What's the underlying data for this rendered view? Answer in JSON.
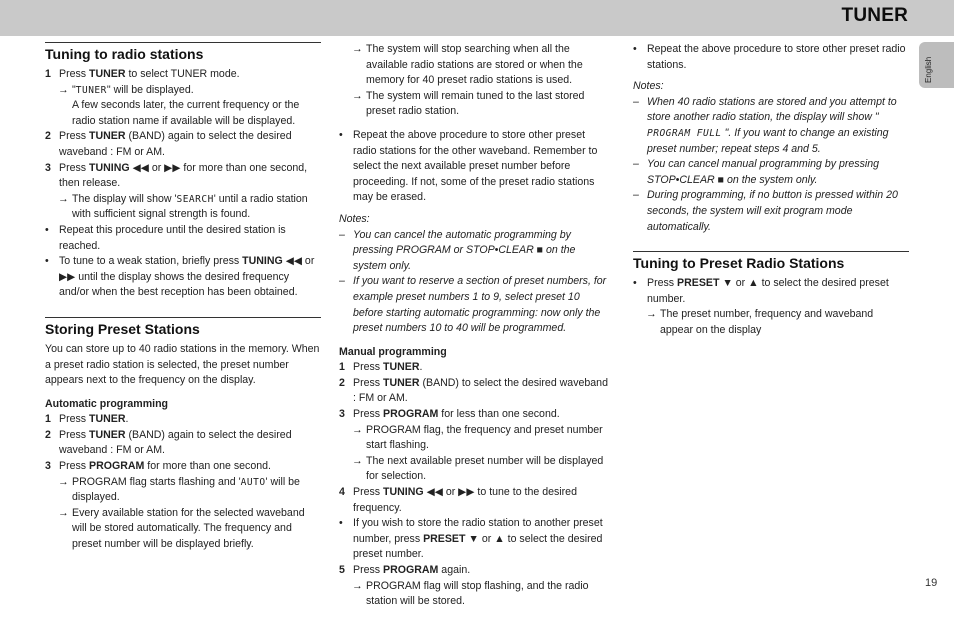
{
  "header": {
    "title": "TUNER",
    "language_tab": "English",
    "page_number": "19"
  },
  "col1": {
    "tuning": {
      "title": "Tuning to radio stations",
      "s1_num": "1",
      "s1_a": "Press ",
      "s1_b": "TUNER",
      "s1_c": " to select TUNER mode.",
      "s1_arrow_a": "\"",
      "s1_arrow_lcd": "TUNER",
      "s1_arrow_c": "\" will be displayed.",
      "s1_cont": "A few seconds later, the current frequency or the radio station name if available will be displayed.",
      "s2_num": "2",
      "s2_a": "Press ",
      "s2_b": "TUNER",
      "s2_c": " (BAND) again to select the desired waveband : FM or AM.",
      "s3_num": "3",
      "s3_a": "Press ",
      "s3_b": "TUNING",
      "s3_c": " ◀◀ or ▶▶ for more than one second, then release.",
      "s3_arrow_a": "The display will show '",
      "s3_arrow_lcd": "SEARCH",
      "s3_arrow_c": "' until a radio station with sufficient signal strength is found.",
      "b1": "Repeat this procedure until the desired station is reached.",
      "b2_a": "To tune to a weak station, briefly press ",
      "b2_b": "TUNING",
      "b2_c": " ◀◀ or ▶▶ until the display shows the desired frequency and/or when the best reception has been obtained."
    },
    "storing": {
      "title": "Storing Preset Stations",
      "intro": "You can store up to 40 radio stations in the memory. When a preset radio station is selected, the preset number appears next to the frequency on the display.",
      "auto_title": "Automatic programming",
      "s1_a": "Press ",
      "s1_b": "TUNER",
      "s1_c": ".",
      "s2_a": "Press ",
      "s2_b": "TUNER",
      "s2_c": " (BAND) again to select the desired waveband : FM or AM.",
      "s3_a": "Press ",
      "s3_b": "PROGRAM",
      "s3_c": " for more than one second.",
      "s3_arrow1_a": "PROGRAM flag starts flashing and '",
      "s3_arrow1_lcd": "AUTO",
      "s3_arrow1_c": "' will be displayed.",
      "s3_arrow2": "Every available station for the selected waveband will be stored automatically. The frequency and preset number will be displayed briefly."
    }
  },
  "col2": {
    "arrow1": "The system  will stop searching when all the available radio stations are stored or when the memory for 40 preset radio stations is used.",
    "arrow2": "The system will remain tuned to the last stored preset radio station.",
    "bullet1": "Repeat the above procedure to store other preset radio stations for the other waveband. Remember to select the next available preset number before proceeding. If not, some of the preset radio stations may be erased.",
    "notes_title": "Notes:",
    "note1": "You can cancel the automatic programming by pressing PROGRAM or STOP•CLEAR  ■  on the system only.",
    "note2": "If you want to reserve a section of  preset numbers, for example preset numbers 1 to 9, select preset 10 before starting automatic programming: now only the preset numbers 10 to 40 will be programmed.",
    "manual_title": "Manual programming",
    "m1_a": "Press ",
    "m1_b": "TUNER",
    "m1_c": ".",
    "m2_a": "Press ",
    "m2_b": "TUNER",
    "m2_c": " (BAND) to select the desired waveband : FM or AM.",
    "m3_a": "Press ",
    "m3_b": "PROGRAM",
    "m3_c": " for less than one second.",
    "m3_arrow1": "PROGRAM flag, the frequency and preset number start flashing.",
    "m3_arrow2": "The next available preset number will be displayed for selection.",
    "m4_a": "Press ",
    "m4_b": "TUNING",
    "m4_c": " ◀◀ or ▶▶ to tune to the desired frequency.",
    "mb_a": "If you wish to store the radio station to another preset number, press ",
    "mb_b": "PRESET",
    "mb_c": " ▼ or ▲ to select the desired preset number.",
    "m5_a": "Press ",
    "m5_b": "PROGRAM",
    "m5_c": " again.",
    "m5_arrow": "PROGRAM flag will stop flashing, and the radio station will be stored."
  },
  "col3": {
    "bullet1": "Repeat the above procedure to store other preset radio stations.",
    "notes_title": "Notes:",
    "note1_a": "When 40 radio stations are stored and you attempt to store another radio station, the display will show \" ",
    "note1_lcd": "PROGRAM FULL",
    "note1_c": " \". If you want to change an existing preset number; repeat steps 4 and 5.",
    "note2": "You can cancel manual programming by pressing STOP•CLEAR  ■  on the system only.",
    "note3": "During programming,  if no button is pressed within 20 seconds, the system will exit program mode automatically.",
    "preset": {
      "title": "Tuning to Preset Radio Stations",
      "b1_a": "Press ",
      "b1_b": "PRESET",
      "b1_c": " ▼ or ▲ to select the desired preset number.",
      "arrow": "The preset number, frequency and waveband appear on the display"
    }
  },
  "glyphs": {
    "arrow": "→",
    "bullet": "•",
    "dash": "–"
  }
}
